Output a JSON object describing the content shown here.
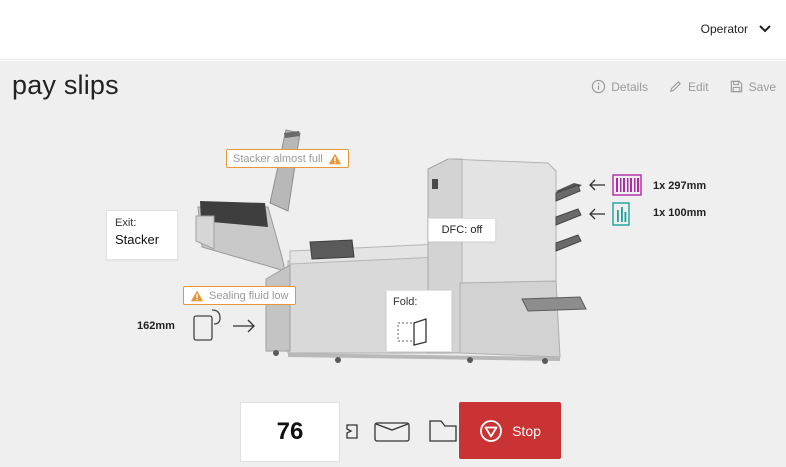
{
  "header": {
    "user_label": "Operator",
    "menu_icon": "chevron-down-icon"
  },
  "job": {
    "title": "pay slips"
  },
  "actions": [
    {
      "label": "Details",
      "icon": "info-circle-icon"
    },
    {
      "label": "Edit",
      "icon": "pencil-icon"
    },
    {
      "label": "Save",
      "icon": "floppy-disk-icon"
    }
  ],
  "warnings": {
    "stacker": "Stacker almost full",
    "sealing": "Sealing fluid low"
  },
  "exit": {
    "label": "Exit:",
    "value": "Stacker"
  },
  "dfc": {
    "label": "DFC: off"
  },
  "fold": {
    "label": "Fold:"
  },
  "envelope": {
    "size": "162mm"
  },
  "feeders": [
    {
      "label": "1x 297mm",
      "icon": "barcode-document-icon",
      "color": "#b02aa3"
    },
    {
      "label": "1x 100mm",
      "icon": "document-icon",
      "color": "#1aa39a"
    }
  ],
  "counter": {
    "value": "76"
  },
  "stop_button": {
    "label": "Stop",
    "color": "#c93333"
  },
  "colors": {
    "warning": "#e9953a",
    "background": "#efefef"
  }
}
